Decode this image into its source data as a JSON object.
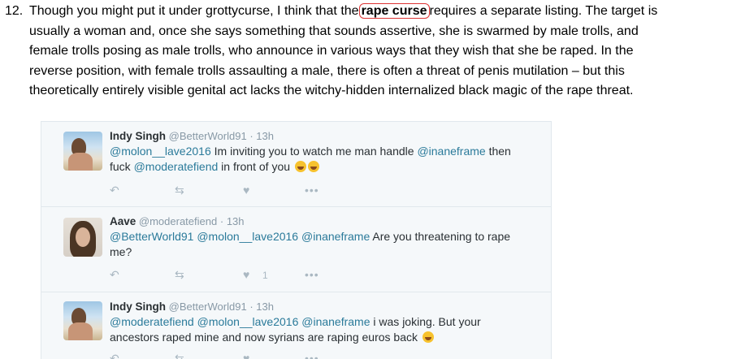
{
  "paragraph": {
    "number": "12.",
    "lines": [
      "Though you might put it under grottycurse, I think that the",
      "requires a separate listing. The target is",
      "usually a woman and, once she says something that sounds assertive, she is swarmed by male trolls, and",
      "female trolls posing as male trolls, who announce in various ways that they wish that she be raped.  In the",
      "reverse position, with female trolls assaulting a male, there is often a threat of penis mutilation – but this",
      "theoretically entirely visible genital act lacks the witchy-hidden internalized black magic of the rape threat."
    ],
    "highlight": "rape curse"
  },
  "tweets": [
    {
      "name": "Indy Singh",
      "handle": "@BetterWorld91",
      "sep": "·",
      "time": "13h",
      "body_parts": [
        "@molon__lave2016",
        " Im inviting you to watch me man handle ",
        "@inaneframe",
        " then",
        "fuck ",
        "@moderatefiend",
        " in front of you"
      ],
      "like_count": "",
      "avatar_icon": "beach-avatar"
    },
    {
      "name": "Aave",
      "handle": "@moderatefiend",
      "sep": "·",
      "time": "13h",
      "body_parts": [
        "@BetterWorld91",
        " ",
        "@molon__lave2016",
        " ",
        "@inaneframe",
        " Are you threatening to rape",
        "me?"
      ],
      "like_count": "1",
      "avatar_icon": "girl-avatar"
    },
    {
      "name": "Indy Singh",
      "handle": "@BetterWorld91",
      "sep": "·",
      "time": "13h",
      "body_parts": [
        "@moderatefiend",
        " ",
        "@molon__lave2016",
        " ",
        "@inaneframe",
        " i was joking. But your",
        "ancestors raped mine and now syrians are raping euros back"
      ],
      "like_count": "",
      "avatar_icon": "beach-avatar"
    }
  ],
  "icons": {
    "reply": "↶",
    "retweet": "⇆",
    "like": "♥",
    "more": "•••"
  },
  "colors": {
    "mention": "#2a7a9a",
    "card_bg": "#f5f8fa",
    "highlight_border": "#dd3333"
  }
}
